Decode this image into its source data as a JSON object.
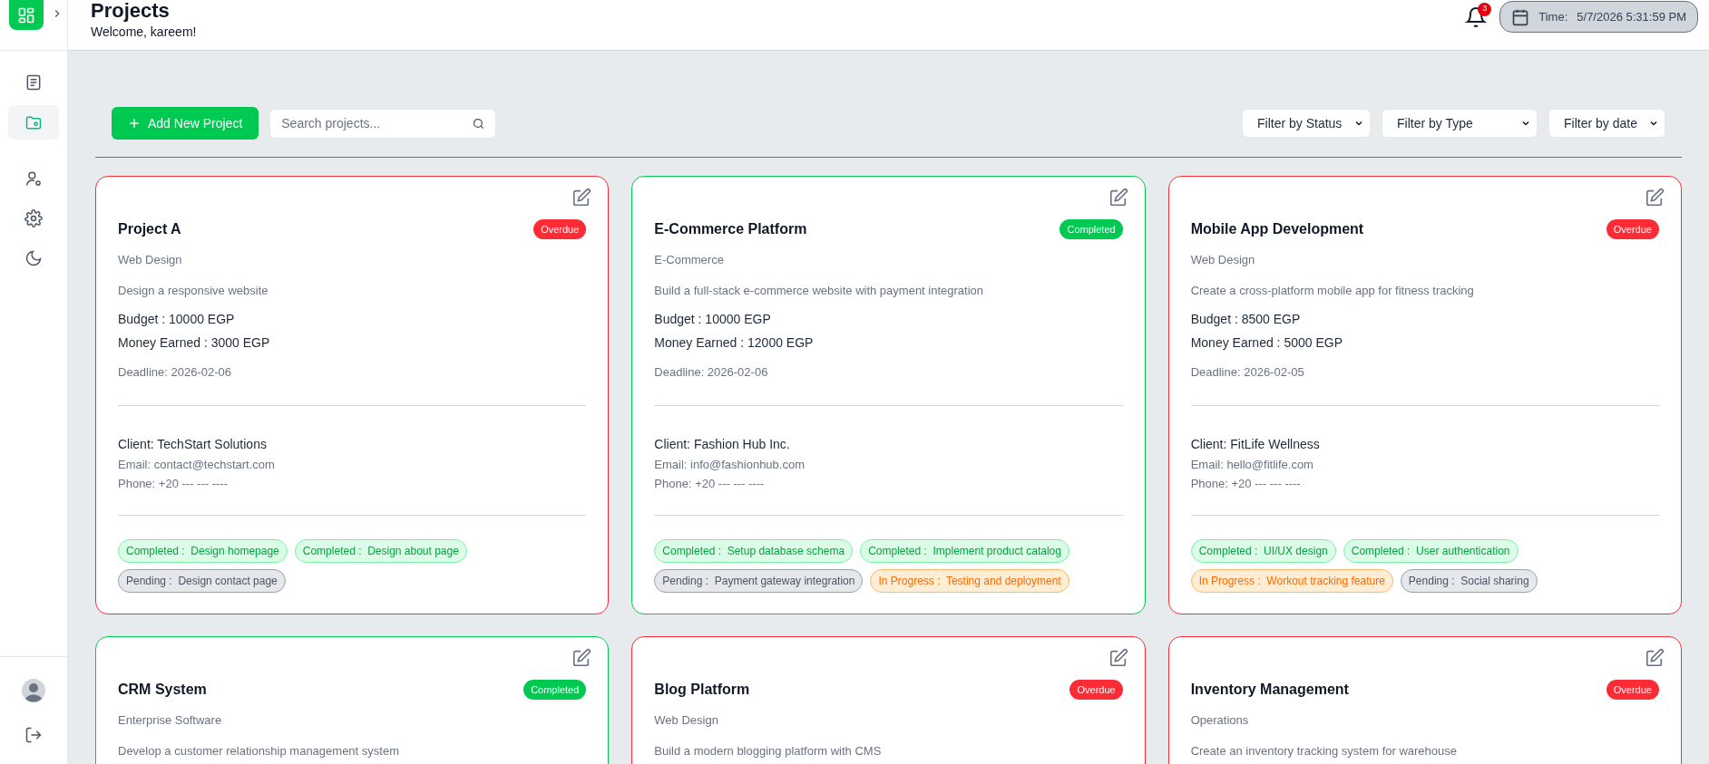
{
  "header": {
    "title": "Projects",
    "subtitle": "Welcome, kareem!",
    "notifications": "3",
    "time_label": "Time:",
    "time_value": "5/7/2026 5:31:59 PM"
  },
  "sidebar": {
    "items": [
      {
        "kind": "list",
        "selected": false
      },
      {
        "kind": "folder",
        "selected": true
      },
      {
        "kind": "user",
        "selected": false
      },
      {
        "kind": "settings",
        "selected": false
      },
      {
        "kind": "moon",
        "selected": false
      }
    ],
    "bottom": [
      {
        "kind": "avatar"
      },
      {
        "kind": "logout"
      }
    ]
  },
  "toolbar": {
    "add_button": "Add New Project",
    "search": {
      "placeholder": "Search projects..."
    },
    "filters": [
      "Filter by Status",
      "Filter by Type",
      "Filter by date"
    ]
  },
  "projects": [
    {
      "title": "Project A",
      "kind": "overdue",
      "status_label": "Overdue",
      "type": "Web Design",
      "description": "Design a responsive website",
      "budget": "Budget : 10000 EGP",
      "earned": "Money Earned : 3000 EGP",
      "deadline": "Deadline: 2026-02-06",
      "client": "Client: TechStart Solutions",
      "email": "Email: contact@techstart.com",
      "phone": "Phone: +20 --- --- ----",
      "tasks": [
        {
          "kind": "completed",
          "label": "Completed :",
          "name": "Design homepage"
        },
        {
          "kind": "completed",
          "label": "Completed :",
          "name": "Design about page"
        },
        {
          "kind": "pending",
          "label": "Pending :",
          "name": "Design contact page"
        }
      ]
    },
    {
      "title": "E-Commerce Platform",
      "kind": "completed",
      "status_label": "Completed",
      "type": "E-Commerce",
      "description": "Build a full-stack e-commerce website with payment integration",
      "budget": "Budget : 10000 EGP",
      "earned": "Money Earned : 12000 EGP",
      "deadline": "Deadline: 2026-02-06",
      "client": "Client: Fashion Hub Inc.",
      "email": "Email: info@fashionhub.com",
      "phone": "Phone: +20 --- --- ----",
      "tasks": [
        {
          "kind": "completed",
          "label": "Completed :",
          "name": "Setup database schema"
        },
        {
          "kind": "completed",
          "label": "Completed :",
          "name": "Implement product catalog"
        },
        {
          "kind": "pending",
          "label": "Pending :",
          "name": "Payment gateway integration"
        },
        {
          "kind": "in_progress",
          "label": "In Progress :",
          "name": "Testing and deployment"
        }
      ]
    },
    {
      "title": "Mobile App Development",
      "kind": "overdue",
      "status_label": "Overdue",
      "type": "Web Design",
      "description": "Create a cross-platform mobile app for fitness tracking",
      "budget": "Budget : 8500 EGP",
      "earned": "Money Earned : 5000 EGP",
      "deadline": "Deadline: 2026-02-05",
      "client": "Client: FitLife Wellness",
      "email": "Email: hello@fitlife.com",
      "phone": "Phone: +20 --- --- ----",
      "tasks": [
        {
          "kind": "completed",
          "label": "Completed :",
          "name": "UI/UX design"
        },
        {
          "kind": "completed",
          "label": "Completed :",
          "name": "User authentication"
        },
        {
          "kind": "in_progress",
          "label": "In Progress :",
          "name": "Workout tracking feature"
        },
        {
          "kind": "pending",
          "label": "Pending :",
          "name": "Social sharing"
        }
      ]
    },
    {
      "title": "CRM System",
      "kind": "completed",
      "status_label": "Completed",
      "type": "Enterprise Software",
      "description": "Develop a customer relationship management system"
    },
    {
      "title": "Blog Platform",
      "kind": "overdue",
      "status_label": "Overdue",
      "type": "Web Design",
      "description": "Build a modern blogging platform with CMS"
    },
    {
      "title": "Inventory Management",
      "kind": "overdue",
      "status_label": "Overdue",
      "type": "Operations",
      "description": "Create an inventory tracking system for warehouse"
    }
  ]
}
